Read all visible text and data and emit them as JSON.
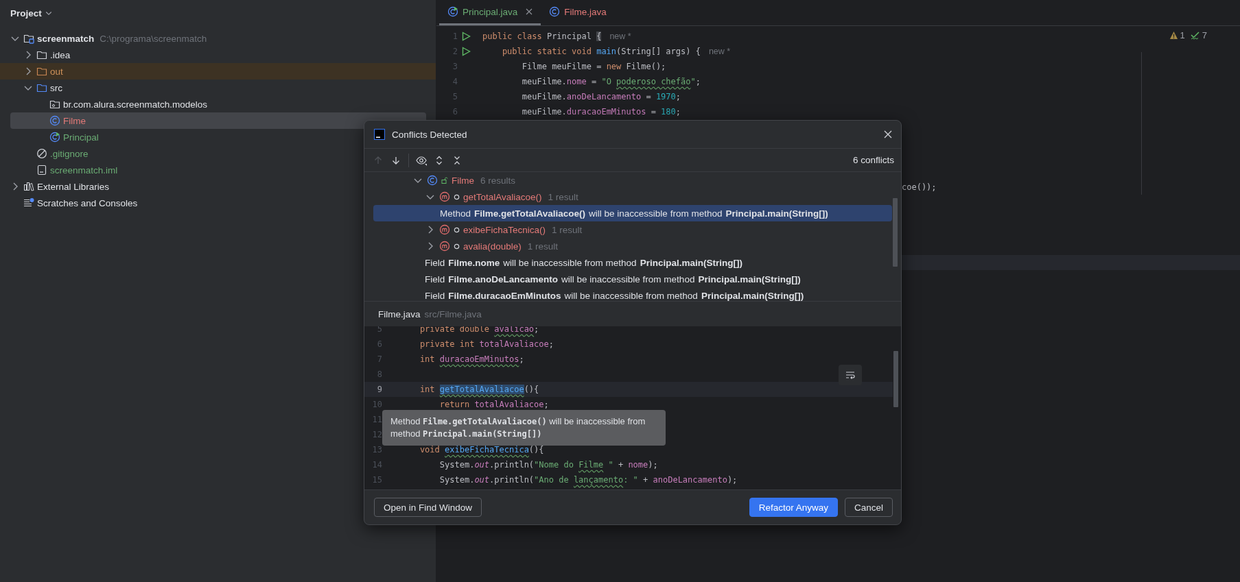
{
  "project_panel": {
    "title": "Project",
    "items": [
      {
        "kind": "project",
        "label": "screenmatch",
        "path": "C:\\programa\\screenmatch",
        "expanded": true,
        "selected": false,
        "color": "#dfe1e5",
        "children": [
          {
            "kind": "folder",
            "label": ".idea",
            "expanded": false,
            "selected": false,
            "color": "#dfe1e5"
          },
          {
            "kind": "excluded-folder",
            "label": "out",
            "expanded": false,
            "selected": false,
            "color": "#d0925a"
          },
          {
            "kind": "source-folder",
            "label": "src",
            "expanded": true,
            "selected": false,
            "color": "#dfe1e5",
            "children": [
              {
                "kind": "package",
                "label": "br.com.alura.screenmatch.modelos",
                "selected": false,
                "color": "#dfe1e5"
              },
              {
                "kind": "class",
                "label": "Filme",
                "selected": true,
                "color": "#e47a78"
              },
              {
                "kind": "main-class",
                "label": "Principal",
                "selected": false,
                "color": "#6aab73"
              }
            ]
          },
          {
            "kind": "ignore-file",
            "label": ".gitignore",
            "selected": false,
            "color": "#6aab73"
          },
          {
            "kind": "module-file",
            "label": "screenmatch.iml",
            "selected": false,
            "color": "#6aab73"
          }
        ]
      },
      {
        "kind": "libraries",
        "label": "External Libraries",
        "expanded": false,
        "selected": false,
        "color": "#dfe1e5"
      },
      {
        "kind": "scratches",
        "label": "Scratches and Consoles",
        "selected": false,
        "color": "#dfe1e5"
      }
    ]
  },
  "tabs": [
    {
      "label": "Principal.java",
      "kind": "main-class",
      "selected": true,
      "closable": true,
      "color": "#6aab73"
    },
    {
      "label": "Filme.java",
      "kind": "class",
      "selected": false,
      "closable": false,
      "color": "#e47a78"
    }
  ],
  "editor": {
    "lines": [
      {
        "number": "1",
        "run": true,
        "hint": "new *",
        "tokens": [
          {
            "kind": "keyword",
            "text": "public class "
          },
          {
            "kind": "plain",
            "text": "Principal "
          },
          {
            "kind": "plain",
            "text": "{",
            "match": true
          }
        ]
      },
      {
        "number": "2",
        "run": true,
        "hint": "new *",
        "tokens": [
          {
            "kind": "keyword",
            "text": "    public static void "
          },
          {
            "kind": "method",
            "text": "main"
          },
          {
            "kind": "plain",
            "text": "(String[] args) {"
          }
        ]
      },
      {
        "number": "3",
        "run": false,
        "tokens": [
          {
            "kind": "plain",
            "text": "        Filme meuFilme = "
          },
          {
            "kind": "keyword",
            "text": "new"
          },
          {
            "kind": "plain",
            "text": " Filme();"
          }
        ]
      },
      {
        "number": "4",
        "run": false,
        "tokens": [
          {
            "kind": "plain",
            "text": "        meuFilme."
          },
          {
            "kind": "field",
            "text": "nome"
          },
          {
            "kind": "plain",
            "text": " = "
          },
          {
            "kind": "string",
            "text": "\"O "
          },
          {
            "kind": "string",
            "text": "poderoso chefão",
            "typo": true
          },
          {
            "kind": "string",
            "text": "\""
          },
          {
            "kind": "plain",
            "text": ";"
          }
        ]
      },
      {
        "number": "5",
        "run": false,
        "tokens": [
          {
            "kind": "plain",
            "text": "        meuFilme."
          },
          {
            "kind": "field",
            "text": "anoDeLancamento"
          },
          {
            "kind": "plain",
            "text": " = "
          },
          {
            "kind": "number",
            "text": "1970"
          },
          {
            "kind": "plain",
            "text": ";"
          }
        ]
      },
      {
        "number": "6",
        "run": false,
        "tokens": [
          {
            "kind": "plain",
            "text": "        meuFilme."
          },
          {
            "kind": "field",
            "text": "duracaoEmMinutos"
          },
          {
            "kind": "plain",
            "text": " = "
          },
          {
            "kind": "number",
            "text": "180"
          },
          {
            "kind": "plain",
            "text": ";"
          }
        ]
      }
    ],
    "fragment": "coe());",
    "caret_line_band": true,
    "inspections": [
      {
        "kind": "warning",
        "count": "1"
      },
      {
        "kind": "typo",
        "count": "7"
      }
    ]
  },
  "dialog": {
    "title": "Conflicts Detected",
    "toolbar": [
      {
        "kind": "up",
        "disabled": true
      },
      {
        "kind": "down",
        "disabled": false
      },
      {
        "kind": "preview",
        "disabled": false
      },
      {
        "kind": "expand-all",
        "disabled": false
      },
      {
        "kind": "collapse-all",
        "disabled": false
      }
    ],
    "summary": "6 conflicts",
    "tree": [
      {
        "kind": "class",
        "label": "Filme",
        "count": "6 results",
        "expanded": true,
        "selected": false,
        "children": [
          {
            "kind": "method",
            "label": "getTotalAvaliacoe()",
            "count": "1 result",
            "expanded": true,
            "selected": false,
            "children": [
              {
                "kind": "usage",
                "text": "Method **Filme.getTotalAvaliacoe()** will be inaccessible from method **Principal.main(String[])**",
                "selected": true
              }
            ]
          },
          {
            "kind": "method",
            "label": "exibeFichaTecnica()",
            "count": "1 result",
            "expanded": false,
            "selected": false
          },
          {
            "kind": "method",
            "label": "avalia(double)",
            "count": "1 result",
            "expanded": false,
            "selected": false
          },
          {
            "kind": "usage",
            "text": "Field **Filme.nome** will be inaccessible from method **Principal.main(String[])**",
            "selected": false
          },
          {
            "kind": "usage",
            "text": "Field **Filme.anoDeLancamento** will be inaccessible from method **Principal.main(String[])**",
            "selected": false
          },
          {
            "kind": "usage",
            "text": "Field **Filme.duracaoEmMinutos** will be inaccessible from method **Principal.main(String[])**",
            "selected": false
          }
        ]
      }
    ],
    "preview": {
      "file": "Filme.java",
      "path": "src/Filme.java",
      "lines": [
        {
          "number": "5",
          "current": false,
          "tokens": [
            {
              "kind": "keyword",
              "text": "    private double "
            },
            {
              "kind": "field",
              "text": "avalicao",
              "typo": true
            },
            {
              "kind": "plain",
              "text": ";"
            }
          ]
        },
        {
          "number": "6",
          "current": false,
          "tokens": [
            {
              "kind": "keyword",
              "text": "    private int "
            },
            {
              "kind": "field",
              "text": "totalAvaliacoe"
            },
            {
              "kind": "plain",
              "text": ";"
            }
          ]
        },
        {
          "number": "7",
          "current": false,
          "tokens": [
            {
              "kind": "keyword",
              "text": "    int "
            },
            {
              "kind": "field",
              "text": "duracaoEmMinutos",
              "typo": true
            },
            {
              "kind": "plain",
              "text": ";"
            }
          ]
        },
        {
          "number": "8",
          "current": false
        },
        {
          "number": "9",
          "current": true,
          "tokens": [
            {
              "kind": "keyword",
              "text": "    int "
            },
            {
              "kind": "method",
              "text": "getTotalAvaliacoe",
              "typo": true,
              "highlight": true
            },
            {
              "kind": "plain",
              "text": "(){"
            }
          ]
        },
        {
          "number": "10",
          "current": false,
          "tokens": [
            {
              "kind": "keyword",
              "text": "        return "
            },
            {
              "kind": "field",
              "text": "totalAvaliacoe"
            },
            {
              "kind": "plain",
              "text": ";"
            }
          ]
        },
        {
          "number": "11",
          "current": false
        },
        {
          "number": "12",
          "current": false
        },
        {
          "number": "13",
          "current": false,
          "tokens": [
            {
              "kind": "keyword",
              "text": "    void "
            },
            {
              "kind": "method",
              "text": "exibeFichaTecnica",
              "typo": true
            },
            {
              "kind": "plain",
              "text": "(){"
            }
          ]
        },
        {
          "number": "14",
          "current": false,
          "tokens": [
            {
              "kind": "plain",
              "text": "        System."
            },
            {
              "kind": "static",
              "text": "out"
            },
            {
              "kind": "plain",
              "text": ".println("
            },
            {
              "kind": "string",
              "text": "\"Nome do "
            },
            {
              "kind": "string",
              "text": "Filme",
              "typo": true
            },
            {
              "kind": "string",
              "text": " \""
            },
            {
              "kind": "plain",
              "text": " + "
            },
            {
              "kind": "field",
              "text": "nome"
            },
            {
              "kind": "plain",
              "text": ");"
            }
          ]
        },
        {
          "number": "15",
          "current": false,
          "tokens": [
            {
              "kind": "plain",
              "text": "        System."
            },
            {
              "kind": "static",
              "text": "out"
            },
            {
              "kind": "plain",
              "text": ".println("
            },
            {
              "kind": "string",
              "text": "\"Ano de "
            },
            {
              "kind": "string",
              "text": "lançamento",
              "typo": true
            },
            {
              "kind": "string",
              "text": ": \""
            },
            {
              "kind": "plain",
              "text": " + "
            },
            {
              "kind": "field",
              "text": "anoDeLancamento"
            },
            {
              "kind": "plain",
              "text": ");"
            }
          ]
        }
      ],
      "tooltip": "Method **Filme.getTotalAvaliacoe()** will be inaccessible from method **Principal.main(String[])**"
    },
    "buttons": [
      {
        "label": "Open in Find Window",
        "kind": "secondary"
      },
      {
        "label": "Refactor Anyway",
        "kind": "primary"
      },
      {
        "label": "Cancel",
        "kind": "secondary"
      }
    ]
  }
}
